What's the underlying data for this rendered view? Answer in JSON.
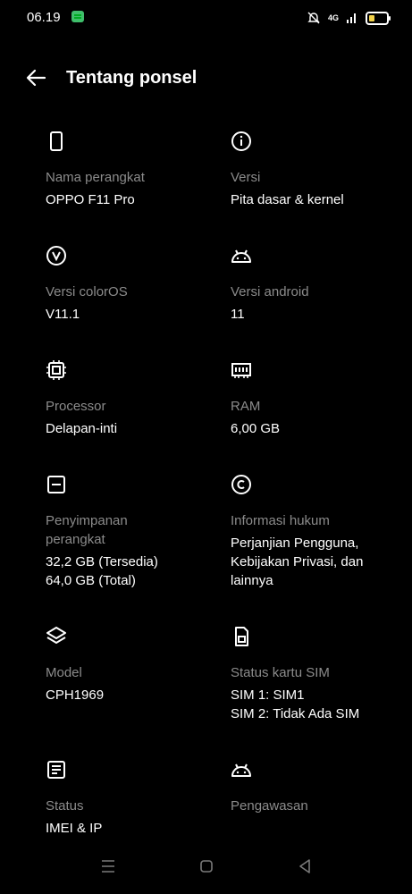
{
  "status_bar": {
    "time": "06.19",
    "network": "4G"
  },
  "header": {
    "title": "Tentang ponsel",
    "back_icon": "arrow-left-icon"
  },
  "items": [
    {
      "icon": "phone-icon",
      "label": "Nama perangkat",
      "value": "OPPO F11 Pro"
    },
    {
      "icon": "info-icon",
      "label": "Versi",
      "value": "Pita dasar & kernel"
    },
    {
      "icon": "coloros-icon",
      "label": "Versi colorOS",
      "value": "V11.1"
    },
    {
      "icon": "android-icon",
      "label": "Versi android",
      "value": "11"
    },
    {
      "icon": "cpu-icon",
      "label": "Processor",
      "value": "Delapan-inti"
    },
    {
      "icon": "ram-icon",
      "label": "RAM",
      "value": "6,00 GB"
    },
    {
      "icon": "storage-icon",
      "label": "Penyimpanan\nperangkat",
      "value": "32,2 GB (Tersedia)\n64,0 GB (Total)"
    },
    {
      "icon": "copyright-icon",
      "label": "Informasi hukum",
      "value": "Perjanjian Pengguna,\nKebijakan Privasi, dan\nlainnya"
    },
    {
      "icon": "layers-icon",
      "label": "Model",
      "value": "CPH1969"
    },
    {
      "icon": "sim-icon",
      "label": "Status kartu SIM",
      "value": "SIM 1: SIM1\nSIM 2: Tidak Ada SIM"
    },
    {
      "icon": "document-icon",
      "label": "Status",
      "value": "IMEI & IP"
    },
    {
      "icon": "android-icon",
      "label": "Pengawasan",
      "value": ""
    }
  ],
  "nav_bar": {
    "menu_icon": "menu-icon",
    "home_icon": "home-icon",
    "back_icon": "back-triangle-icon"
  }
}
